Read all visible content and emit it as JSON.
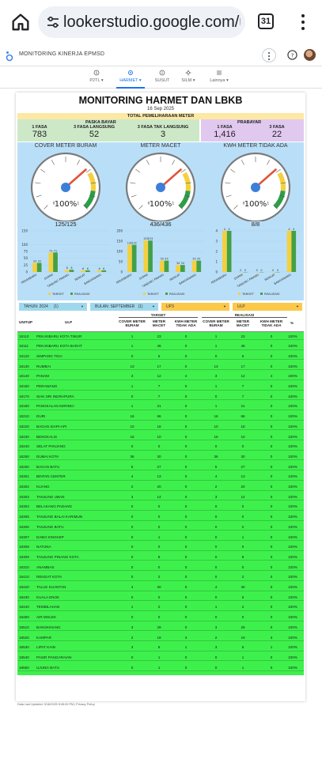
{
  "browser": {
    "url": "lookerstudio.google.com/u/0",
    "tab_count": "31",
    "icons": {
      "home": "home-icon",
      "site_info": "tune-icon",
      "menu": "kebab-menu-icon"
    }
  },
  "app": {
    "title": "MONITORING KINERJA EPMSD",
    "icons": {
      "logo": "looker-studio-logo-icon",
      "more": "more-vertical-icon",
      "help": "help-icon",
      "avatar": "avatar"
    }
  },
  "nav": {
    "items": [
      {
        "label": "P2TL ▾",
        "icon": "p2tl-icon",
        "active": false
      },
      {
        "label": "HARMET ▾",
        "icon": "harmet-icon",
        "active": true
      },
      {
        "label": "SUSUT",
        "icon": "info-icon",
        "active": false
      },
      {
        "label": "SILM ▾",
        "icon": "silm-icon",
        "active": false
      },
      {
        "label": "Lainnya ▾",
        "icon": "list-icon",
        "active": false
      }
    ]
  },
  "report": {
    "title": "MONITORING HARMET DAN LBKB",
    "date": "16 Sep 2025",
    "total_label": "TOTAL PEMELIHARAAN METER",
    "paska": {
      "title": "PASKA BAYAR",
      "metrics": [
        {
          "label": "1 FASA",
          "value": "783"
        },
        {
          "label": "3 FASA LANGSUNG",
          "value": "52"
        },
        {
          "label": "3 FASA TAK LANGSUNG",
          "value": "3"
        }
      ]
    },
    "prabayar": {
      "title": "PRABAYAR",
      "metrics": [
        {
          "label": "1 FASA",
          "value": "1,416"
        },
        {
          "label": "3 FASA",
          "value": "22"
        }
      ]
    },
    "colors": {
      "paska_bg": "#cde8c7",
      "prabayar_bg": "#e1c8ef",
      "gauge_bg": "#b9dff8",
      "rows_bg": "#3ef04c",
      "target": "#f4d03f",
      "realisasi": "#43a047"
    },
    "gauges": [
      {
        "title": "COVER METER BURAM",
        "percent_label": "100%",
        "percent": 100,
        "count": "125/125"
      },
      {
        "title": "METER MACET",
        "percent_label": "100%",
        "percent": 100,
        "count": "436/436"
      },
      {
        "title": "KWH METER TIDAK ADA",
        "percent_label": "100%",
        "percent": 100,
        "count": "8/8"
      }
    ],
    "gauge_scale": {
      "min": "0",
      "max": "1"
    },
    "legend": {
      "target": "TARGET",
      "realisasi": "REALISASI"
    },
    "filters": [
      {
        "label": "TAHUN: 2024",
        "extra": "(1)"
      },
      {
        "label": "BULAN: SEPTEMBER",
        "extra": "(1)"
      },
      {
        "label": "UP3",
        "extra": ""
      },
      {
        "label": "ULP",
        "extra": ""
      }
    ],
    "table": {
      "headers": {
        "unitup": "UNITUP",
        "ulp": "ULP",
        "target": "TARGET",
        "realisasi": "REALISASI",
        "percent": "%",
        "sub": [
          "COVER METER BURAM",
          "METER MACET",
          "KWH METER TIDAK ADA",
          "COVER METER BURAM",
          "METER MACET",
          "KWH METER TIDAK ADA"
        ]
      },
      "rows": [
        [
          "18110",
          "PEKANBARU KOTA TIMUR",
          "1",
          "23",
          "0",
          "1",
          "23",
          "0",
          "100%"
        ],
        [
          "18111",
          "PEKANBARU KOTA BARAT",
          "1",
          "46",
          "0",
          "1",
          "46",
          "0",
          "100%"
        ],
        [
          "18120",
          "SIMPANG TIGA",
          "0",
          "6",
          "0",
          "0",
          "6",
          "0",
          "100%"
        ],
        [
          "18130",
          "RUMBAI",
          "13",
          "17",
          "0",
          "13",
          "17",
          "0",
          "100%"
        ],
        [
          "18140",
          "PANAM",
          "3",
          "12",
          "4",
          "3",
          "12",
          "4",
          "100%"
        ],
        [
          "18150",
          "PERAWANG",
          "1",
          "7",
          "0",
          "1",
          "7",
          "0",
          "100%"
        ],
        [
          "18170",
          "SIAK SRI INDRAPURA",
          "0",
          "7",
          "0",
          "0",
          "7",
          "0",
          "100%"
        ],
        [
          "18180",
          "PANGKALAN KERINCI",
          "1",
          "21",
          "0",
          "1",
          "21",
          "0",
          "100%"
        ],
        [
          "18210",
          "DURI",
          "16",
          "66",
          "0",
          "16",
          "66",
          "0",
          "100%"
        ],
        [
          "18220",
          "BAGAN SIAPI-API",
          "10",
          "18",
          "0",
          "10",
          "18",
          "0",
          "100%"
        ],
        [
          "18230",
          "BENGKALIS",
          "16",
          "10",
          "0",
          "16",
          "10",
          "0",
          "100%"
        ],
        [
          "18240",
          "SELAT PANJANG",
          "0",
          "0",
          "0",
          "0",
          "0",
          "0",
          "100%"
        ],
        [
          "18250",
          "DUMAI KOTA",
          "36",
          "30",
          "0",
          "36",
          "30",
          "0",
          "100%"
        ],
        [
          "18260",
          "BAGAN BATU",
          "5",
          "27",
          "0",
          "5",
          "27",
          "0",
          "100%"
        ],
        [
          "18301",
          "BINTAN CENTER",
          "4",
          "13",
          "0",
          "4",
          "13",
          "0",
          "100%"
        ],
        [
          "18302",
          "KIJANG",
          "2",
          "20",
          "0",
          "2",
          "20",
          "0",
          "100%"
        ],
        [
          "18303",
          "TANJUNG UBAN",
          "3",
          "14",
          "0",
          "3",
          "14",
          "0",
          "100%"
        ],
        [
          "18304",
          "BELAKANG PADANG",
          "0",
          "0",
          "0",
          "0",
          "0",
          "0",
          "100%"
        ],
        [
          "18305",
          "TANJUNG BALAI KARIMUN",
          "0",
          "0",
          "0",
          "0",
          "0",
          "0",
          "100%"
        ],
        [
          "18306",
          "TANJUNG BATU",
          "0",
          "0",
          "0",
          "0",
          "0",
          "0",
          "100%"
        ],
        [
          "18307",
          "DABO SINGKEP",
          "0",
          "1",
          "0",
          "0",
          "1",
          "0",
          "100%"
        ],
        [
          "18308",
          "NATUNA",
          "0",
          "0",
          "0",
          "0",
          "0",
          "0",
          "100%"
        ],
        [
          "18309",
          "TANJUNG PINANG KOTA",
          "0",
          "8",
          "0",
          "0",
          "8",
          "0",
          "100%"
        ],
        [
          "18310",
          "ANAMBAS",
          "0",
          "0",
          "0",
          "0",
          "0",
          "0",
          "100%"
        ],
        [
          "18410",
          "RENGAT KOTA",
          "0",
          "2",
          "0",
          "0",
          "2",
          "0",
          "100%"
        ],
        [
          "18420",
          "TALUK KUANTAN",
          "4",
          "30",
          "0",
          "4",
          "30",
          "0",
          "100%"
        ],
        [
          "18430",
          "KUALA ENOK",
          "0",
          "0",
          "0",
          "0",
          "0",
          "0",
          "100%"
        ],
        [
          "18440",
          "TEMBILAHAN",
          "1",
          "2",
          "0",
          "1",
          "2",
          "0",
          "100%"
        ],
        [
          "18450",
          "AIR MOLEK",
          "0",
          "0",
          "0",
          "0",
          "0",
          "0",
          "100%"
        ],
        [
          "18510",
          "BANGKINANG",
          "3",
          "29",
          "0",
          "3",
          "29",
          "0",
          "100%"
        ],
        [
          "18520",
          "KAMPAR",
          "2",
          "19",
          "3",
          "2",
          "19",
          "3",
          "100%"
        ],
        [
          "18530",
          "LIPAT KAIN",
          "3",
          "6",
          "1",
          "3",
          "6",
          "1",
          "100%"
        ],
        [
          "18540",
          "PASIR PANGARAIAN",
          "0",
          "1",
          "0",
          "0",
          "1",
          "0",
          "100%"
        ],
        [
          "18550",
          "UJUNG BATU",
          "0",
          "1",
          "0",
          "0",
          "1",
          "0",
          "100%"
        ]
      ]
    },
    "footer": "Data Last Updated: 9/16/2025 8:08:00 PM | Privacy Policy"
  },
  "chart_data": [
    {
      "type": "bar",
      "title": "",
      "categories": [
        "PEKANBARU",
        "DUMAI",
        "TANJUNG PINANG",
        "RENGAT",
        "BANGKINANG"
      ],
      "series": [
        {
          "name": "TARGET",
          "values": [
            33,
            71,
            8,
            6,
            6
          ]
        },
        {
          "name": "REALISASI",
          "values": [
            33,
            71,
            8,
            6,
            6
          ]
        }
      ],
      "data_labels": [
        "33",
        "33",
        "71",
        "71",
        "8",
        "8",
        "6",
        "6",
        "6",
        "6"
      ],
      "ylim": [
        0,
        150
      ],
      "yticks": [
        "0",
        "25",
        "50",
        "75",
        "100",
        "150"
      ],
      "legend": "bottom"
    },
    {
      "type": "bar",
      "title": "",
      "categories": [
        "PEKANBARU",
        "DUMAI",
        "TANJUNG PINANG",
        "RENGAT",
        "BANGKINANG"
      ],
      "series": [
        {
          "name": "TARGET",
          "values": [
            132,
            153,
            55,
            34,
            55
          ]
        },
        {
          "name": "REALISASI",
          "values": [
            132,
            153,
            55,
            34,
            55
          ]
        }
      ],
      "data_labels": [
        "132",
        "132",
        "153",
        "153",
        "55",
        "55",
        "34",
        "34",
        "55",
        "55"
      ],
      "ylim": [
        0,
        200
      ],
      "yticks": [
        "0",
        "50",
        "100",
        "150",
        "200"
      ],
      "legend": "bottom"
    },
    {
      "type": "bar",
      "title": "",
      "categories": [
        "PEKANBARU",
        "DUMAI",
        "TANJUNG PINANG",
        "RENGAT",
        "BANGKINANG"
      ],
      "series": [
        {
          "name": "TARGET",
          "values": [
            4,
            0,
            0,
            0,
            4
          ]
        },
        {
          "name": "REALISASI",
          "values": [
            4,
            0,
            0,
            0,
            4
          ]
        }
      ],
      "data_labels": [
        "4",
        "4",
        "0",
        "0",
        "0",
        "0",
        "0",
        "0",
        "4",
        "4"
      ],
      "ylim": [
        0,
        4
      ],
      "yticks": [
        "0",
        "1",
        "2",
        "3",
        "4"
      ],
      "legend": "bottom"
    }
  ]
}
